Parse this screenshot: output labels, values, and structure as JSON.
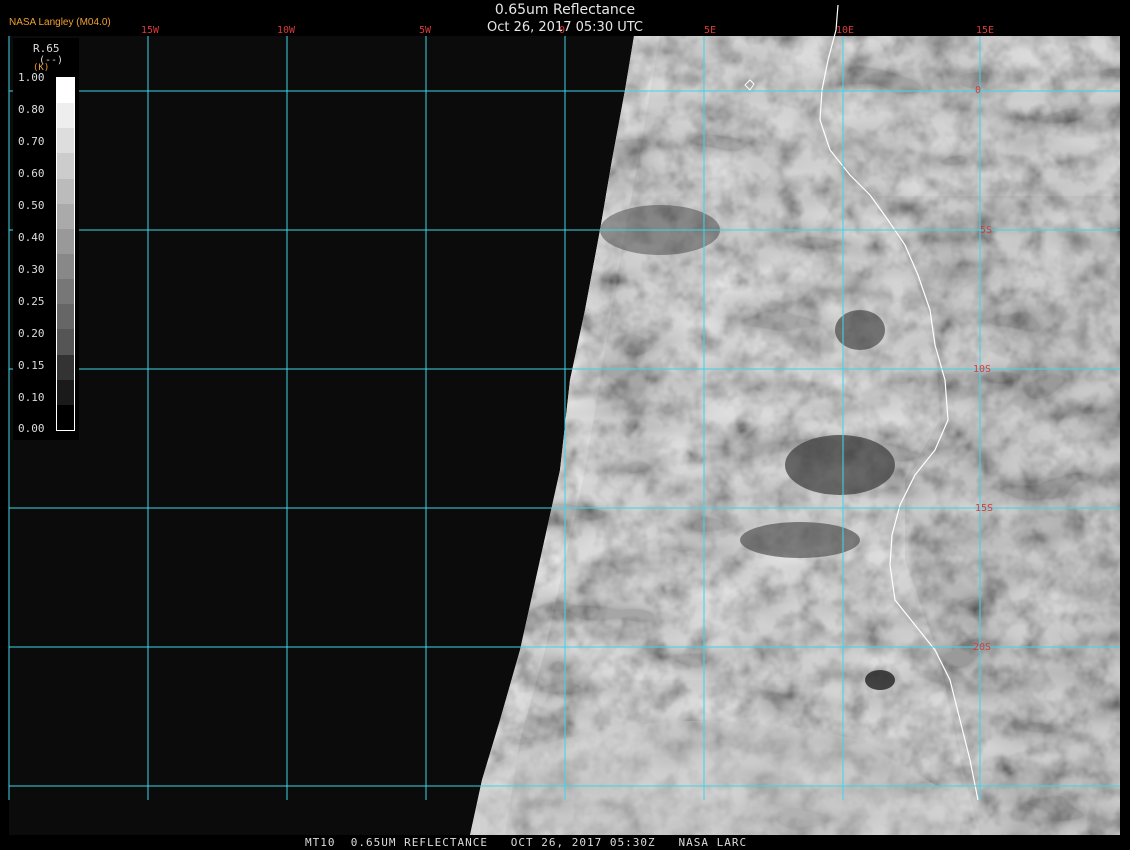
{
  "header": {
    "title": "0.65um Reflectance",
    "subtitle": "Oct 26, 2017 05:30 UTC",
    "brand": "NASA Langley (M04.0)"
  },
  "legend": {
    "title": "R.65",
    "units": "(--)",
    "k_label": "(K)",
    "labels": [
      "1.00",
      "0.80",
      "0.70",
      "0.60",
      "0.50",
      "0.40",
      "0.30",
      "0.25",
      "0.20",
      "0.15",
      "0.10",
      "0.00"
    ],
    "swatch_colors": [
      "#ffffff",
      "#eeeeee",
      "#dddddd",
      "#cccccc",
      "#bbbbbb",
      "#aaaaaa",
      "#999999",
      "#888888",
      "#777777",
      "#666666",
      "#555555",
      "#333333",
      "#1a1a1a",
      "#000000"
    ]
  },
  "map": {
    "lon_labels": [
      "15W",
      "10W",
      "5W",
      "0",
      "5E",
      "10E",
      "15E"
    ],
    "lat_labels": [
      "0",
      "5S",
      "10S",
      "15S",
      "20S"
    ],
    "grid_color": "#3fd6e6",
    "label_color": "#d83a3a",
    "coast_color": "#ffffff"
  },
  "footer": {
    "text": "MT10  0.65UM REFLECTANCE   OCT 26, 2017 05:30Z   NASA LARC"
  }
}
